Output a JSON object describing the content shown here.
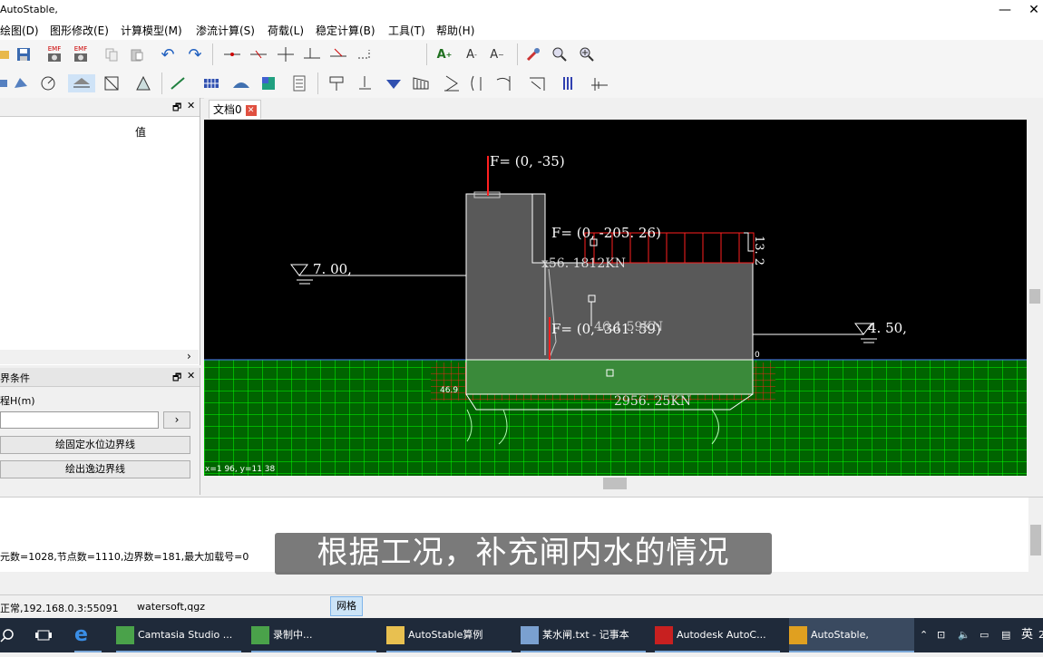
{
  "window": {
    "title": "AutoStable,",
    "min": "—",
    "close": "✕"
  },
  "menu": [
    "绘图(D)",
    "图形修改(E)",
    "计算模型(M)",
    "渗流计算(S)",
    "荷载(L)",
    "稳定计算(B)",
    "工具(T)",
    "帮助(H)"
  ],
  "toolbar1": {
    "emf1": "EMF",
    "emf2": "EMF",
    "text_a1": "A",
    "text_a2": "A",
    "text_a3": "A"
  },
  "leftTop": {
    "pin": "🗗",
    "close": "✕",
    "col_value": "值",
    "scroll_right": "›"
  },
  "leftBottom": {
    "title": "界条件",
    "pin": "🗗",
    "close": "✕",
    "field_label": "程H(m)",
    "field_value": "",
    "arrow": "›",
    "btn1": "绘固定水位边界线",
    "btn2": "绘出逸边界线"
  },
  "doc": {
    "tab": "文档0",
    "close": "✕"
  },
  "drawing": {
    "force_top": "F= (0, -35)",
    "force_mid": "F= (0, -205. 26)",
    "force_low": "F= (0, -361. 59)",
    "kn_upper": "x56. 1812KN",
    "kn_low_overlap": "46.1 59KN",
    "kn_base": "2956. 25KN",
    "level_left": "7. 00,",
    "level_right": "4. 50,",
    "dim_right": "13. 2",
    "node_left": "46.9",
    "zero": "0",
    "coords": "x=1 96, y=11 38"
  },
  "output": {
    "stats": "元数=1028,节点数=1110,边界数=181,最大加载号=0",
    "subtitle": "根据工况，补充闸内水的情况"
  },
  "status": {
    "conn": "正常,192.168.0.3:55091",
    "user": "watersoft,qgz",
    "grid": "网格"
  },
  "taskbar": [
    {
      "label": "Camtasia Studio ..."
    },
    {
      "label": "录制中..."
    },
    {
      "label": "AutoStable算例"
    },
    {
      "label": "某水闸.txt - 记事本"
    },
    {
      "label": "Autodesk AutoC..."
    },
    {
      "label": "AutoStable,"
    }
  ],
  "tray": {
    "ime": "英",
    "day": "2"
  },
  "colors": {
    "mesh": "#00ff00",
    "ground": "#006400",
    "structure": "#595959",
    "load": "#ff2020"
  }
}
